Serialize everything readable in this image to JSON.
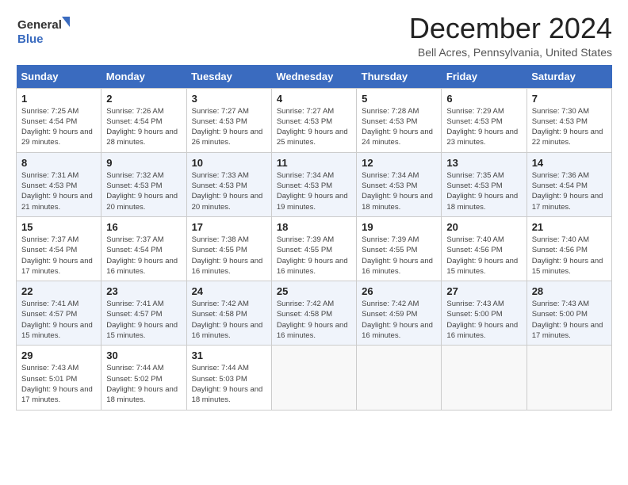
{
  "logo": {
    "line1": "General",
    "line2": "Blue"
  },
  "title": "December 2024",
  "location": "Bell Acres, Pennsylvania, United States",
  "days_of_week": [
    "Sunday",
    "Monday",
    "Tuesday",
    "Wednesday",
    "Thursday",
    "Friday",
    "Saturday"
  ],
  "weeks": [
    [
      {
        "day": 1,
        "sunrise": "7:25 AM",
        "sunset": "4:54 PM",
        "daylight": "9 hours and 29 minutes."
      },
      {
        "day": 2,
        "sunrise": "7:26 AM",
        "sunset": "4:54 PM",
        "daylight": "9 hours and 28 minutes."
      },
      {
        "day": 3,
        "sunrise": "7:27 AM",
        "sunset": "4:53 PM",
        "daylight": "9 hours and 26 minutes."
      },
      {
        "day": 4,
        "sunrise": "7:27 AM",
        "sunset": "4:53 PM",
        "daylight": "9 hours and 25 minutes."
      },
      {
        "day": 5,
        "sunrise": "7:28 AM",
        "sunset": "4:53 PM",
        "daylight": "9 hours and 24 minutes."
      },
      {
        "day": 6,
        "sunrise": "7:29 AM",
        "sunset": "4:53 PM",
        "daylight": "9 hours and 23 minutes."
      },
      {
        "day": 7,
        "sunrise": "7:30 AM",
        "sunset": "4:53 PM",
        "daylight": "9 hours and 22 minutes."
      }
    ],
    [
      {
        "day": 8,
        "sunrise": "7:31 AM",
        "sunset": "4:53 PM",
        "daylight": "9 hours and 21 minutes."
      },
      {
        "day": 9,
        "sunrise": "7:32 AM",
        "sunset": "4:53 PM",
        "daylight": "9 hours and 20 minutes."
      },
      {
        "day": 10,
        "sunrise": "7:33 AM",
        "sunset": "4:53 PM",
        "daylight": "9 hours and 20 minutes."
      },
      {
        "day": 11,
        "sunrise": "7:34 AM",
        "sunset": "4:53 PM",
        "daylight": "9 hours and 19 minutes."
      },
      {
        "day": 12,
        "sunrise": "7:34 AM",
        "sunset": "4:53 PM",
        "daylight": "9 hours and 18 minutes."
      },
      {
        "day": 13,
        "sunrise": "7:35 AM",
        "sunset": "4:53 PM",
        "daylight": "9 hours and 18 minutes."
      },
      {
        "day": 14,
        "sunrise": "7:36 AM",
        "sunset": "4:54 PM",
        "daylight": "9 hours and 17 minutes."
      }
    ],
    [
      {
        "day": 15,
        "sunrise": "7:37 AM",
        "sunset": "4:54 PM",
        "daylight": "9 hours and 17 minutes."
      },
      {
        "day": 16,
        "sunrise": "7:37 AM",
        "sunset": "4:54 PM",
        "daylight": "9 hours and 16 minutes."
      },
      {
        "day": 17,
        "sunrise": "7:38 AM",
        "sunset": "4:55 PM",
        "daylight": "9 hours and 16 minutes."
      },
      {
        "day": 18,
        "sunrise": "7:39 AM",
        "sunset": "4:55 PM",
        "daylight": "9 hours and 16 minutes."
      },
      {
        "day": 19,
        "sunrise": "7:39 AM",
        "sunset": "4:55 PM",
        "daylight": "9 hours and 16 minutes."
      },
      {
        "day": 20,
        "sunrise": "7:40 AM",
        "sunset": "4:56 PM",
        "daylight": "9 hours and 15 minutes."
      },
      {
        "day": 21,
        "sunrise": "7:40 AM",
        "sunset": "4:56 PM",
        "daylight": "9 hours and 15 minutes."
      }
    ],
    [
      {
        "day": 22,
        "sunrise": "7:41 AM",
        "sunset": "4:57 PM",
        "daylight": "9 hours and 15 minutes."
      },
      {
        "day": 23,
        "sunrise": "7:41 AM",
        "sunset": "4:57 PM",
        "daylight": "9 hours and 15 minutes."
      },
      {
        "day": 24,
        "sunrise": "7:42 AM",
        "sunset": "4:58 PM",
        "daylight": "9 hours and 16 minutes."
      },
      {
        "day": 25,
        "sunrise": "7:42 AM",
        "sunset": "4:58 PM",
        "daylight": "9 hours and 16 minutes."
      },
      {
        "day": 26,
        "sunrise": "7:42 AM",
        "sunset": "4:59 PM",
        "daylight": "9 hours and 16 minutes."
      },
      {
        "day": 27,
        "sunrise": "7:43 AM",
        "sunset": "5:00 PM",
        "daylight": "9 hours and 16 minutes."
      },
      {
        "day": 28,
        "sunrise": "7:43 AM",
        "sunset": "5:00 PM",
        "daylight": "9 hours and 17 minutes."
      }
    ],
    [
      {
        "day": 29,
        "sunrise": "7:43 AM",
        "sunset": "5:01 PM",
        "daylight": "9 hours and 17 minutes."
      },
      {
        "day": 30,
        "sunrise": "7:44 AM",
        "sunset": "5:02 PM",
        "daylight": "9 hours and 18 minutes."
      },
      {
        "day": 31,
        "sunrise": "7:44 AM",
        "sunset": "5:03 PM",
        "daylight": "9 hours and 18 minutes."
      },
      null,
      null,
      null,
      null
    ]
  ]
}
